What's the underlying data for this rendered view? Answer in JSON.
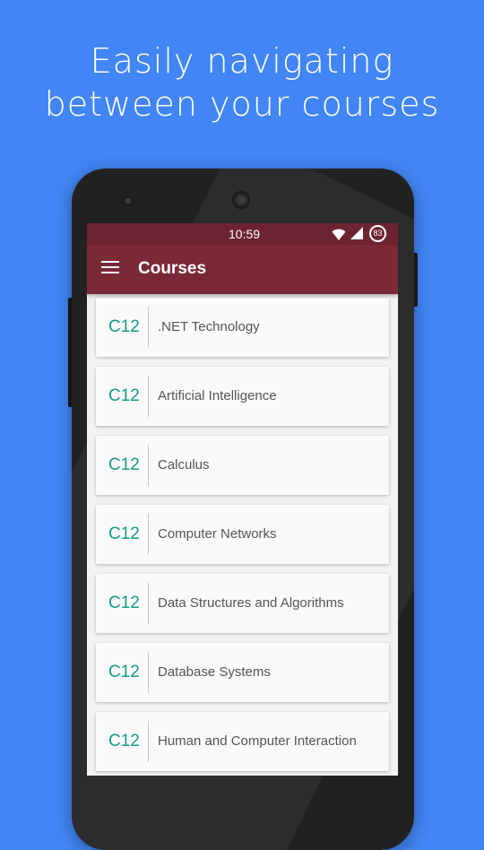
{
  "headline": {
    "line1": "Easily navigating",
    "line2": "between your courses"
  },
  "colors": {
    "background": "#4285f4",
    "toolbar": "#7a2937",
    "statusbar": "#6e2430",
    "course_code": "#159a86"
  },
  "status_bar": {
    "time": "10:59",
    "battery_level": "83",
    "icons": [
      "wifi-icon",
      "signal-icon",
      "battery-icon"
    ]
  },
  "toolbar": {
    "menu_icon": "hamburger-menu-icon",
    "title": "Courses"
  },
  "courses": [
    {
      "code": "C12",
      "name": ".NET Technology"
    },
    {
      "code": "C12",
      "name": "Artificial Intelligence"
    },
    {
      "code": "C12",
      "name": "Calculus"
    },
    {
      "code": "C12",
      "name": "Computer Networks"
    },
    {
      "code": "C12",
      "name": "Data Structures and Algorithms"
    },
    {
      "code": "C12",
      "name": "Database Systems"
    },
    {
      "code": "C12",
      "name": "Human and Computer Interaction"
    }
  ]
}
